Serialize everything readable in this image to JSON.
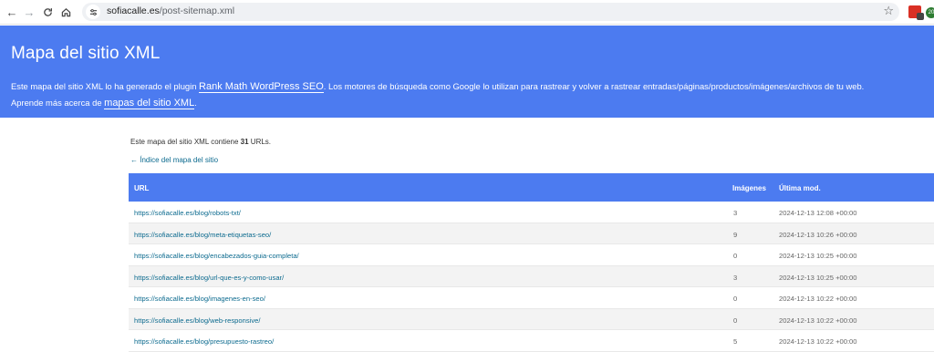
{
  "browser": {
    "url_domain": "sofiacalle.es",
    "url_path": "/post-sitemap.xml",
    "ext_badge": "20"
  },
  "header": {
    "title": "Mapa del sitio XML",
    "desc_part1": "Este mapa del sitio XML lo ha generado el plugin ",
    "plugin_link": "Rank Math WordPress SEO",
    "desc_part2": ". Los motores de búsqueda como Google lo utilizan para rastrear y volver a rastrear entradas/páginas/productos/imágenes/archivos de tu web.",
    "desc_part3": "Aprende más acerca de ",
    "learn_link": "mapas del sitio XML",
    "desc_end": "."
  },
  "summary": {
    "prefix": "Este mapa del sitio XML contiene ",
    "count": "31",
    "suffix": " URLs."
  },
  "index_link": "← Índice del mapa del sitio",
  "table": {
    "headers": {
      "url": "URL",
      "images": "Imágenes",
      "lastmod": "Última mod."
    },
    "rows": [
      {
        "url": "https://sofiacalle.es/blog/robots-txt/",
        "images": "3",
        "lastmod": "2024-12-13 12:08 +00:00"
      },
      {
        "url": "https://sofiacalle.es/blog/meta-etiquetas-seo/",
        "images": "9",
        "lastmod": "2024-12-13 10:26 +00:00"
      },
      {
        "url": "https://sofiacalle.es/blog/encabezados-guia-completa/",
        "images": "0",
        "lastmod": "2024-12-13 10:25 +00:00"
      },
      {
        "url": "https://sofiacalle.es/blog/url-que-es-y-como-usar/",
        "images": "3",
        "lastmod": "2024-12-13 10:25 +00:00"
      },
      {
        "url": "https://sofiacalle.es/blog/imagenes-en-seo/",
        "images": "0",
        "lastmod": "2024-12-13 10:22 +00:00"
      },
      {
        "url": "https://sofiacalle.es/blog/web-responsive/",
        "images": "0",
        "lastmod": "2024-12-13 10:22 +00:00"
      },
      {
        "url": "https://sofiacalle.es/blog/presupuesto-rastreo/",
        "images": "5",
        "lastmod": "2024-12-13 10:22 +00:00"
      }
    ]
  },
  "colors": {
    "accent": "#4c7bf0",
    "link": "#0d6b8f",
    "row_alt": "#f3f3f3"
  },
  "icons": [
    "back-icon",
    "forward-icon",
    "reload-icon",
    "home-icon",
    "site-info-icon",
    "star-icon",
    "extension-icon"
  ]
}
